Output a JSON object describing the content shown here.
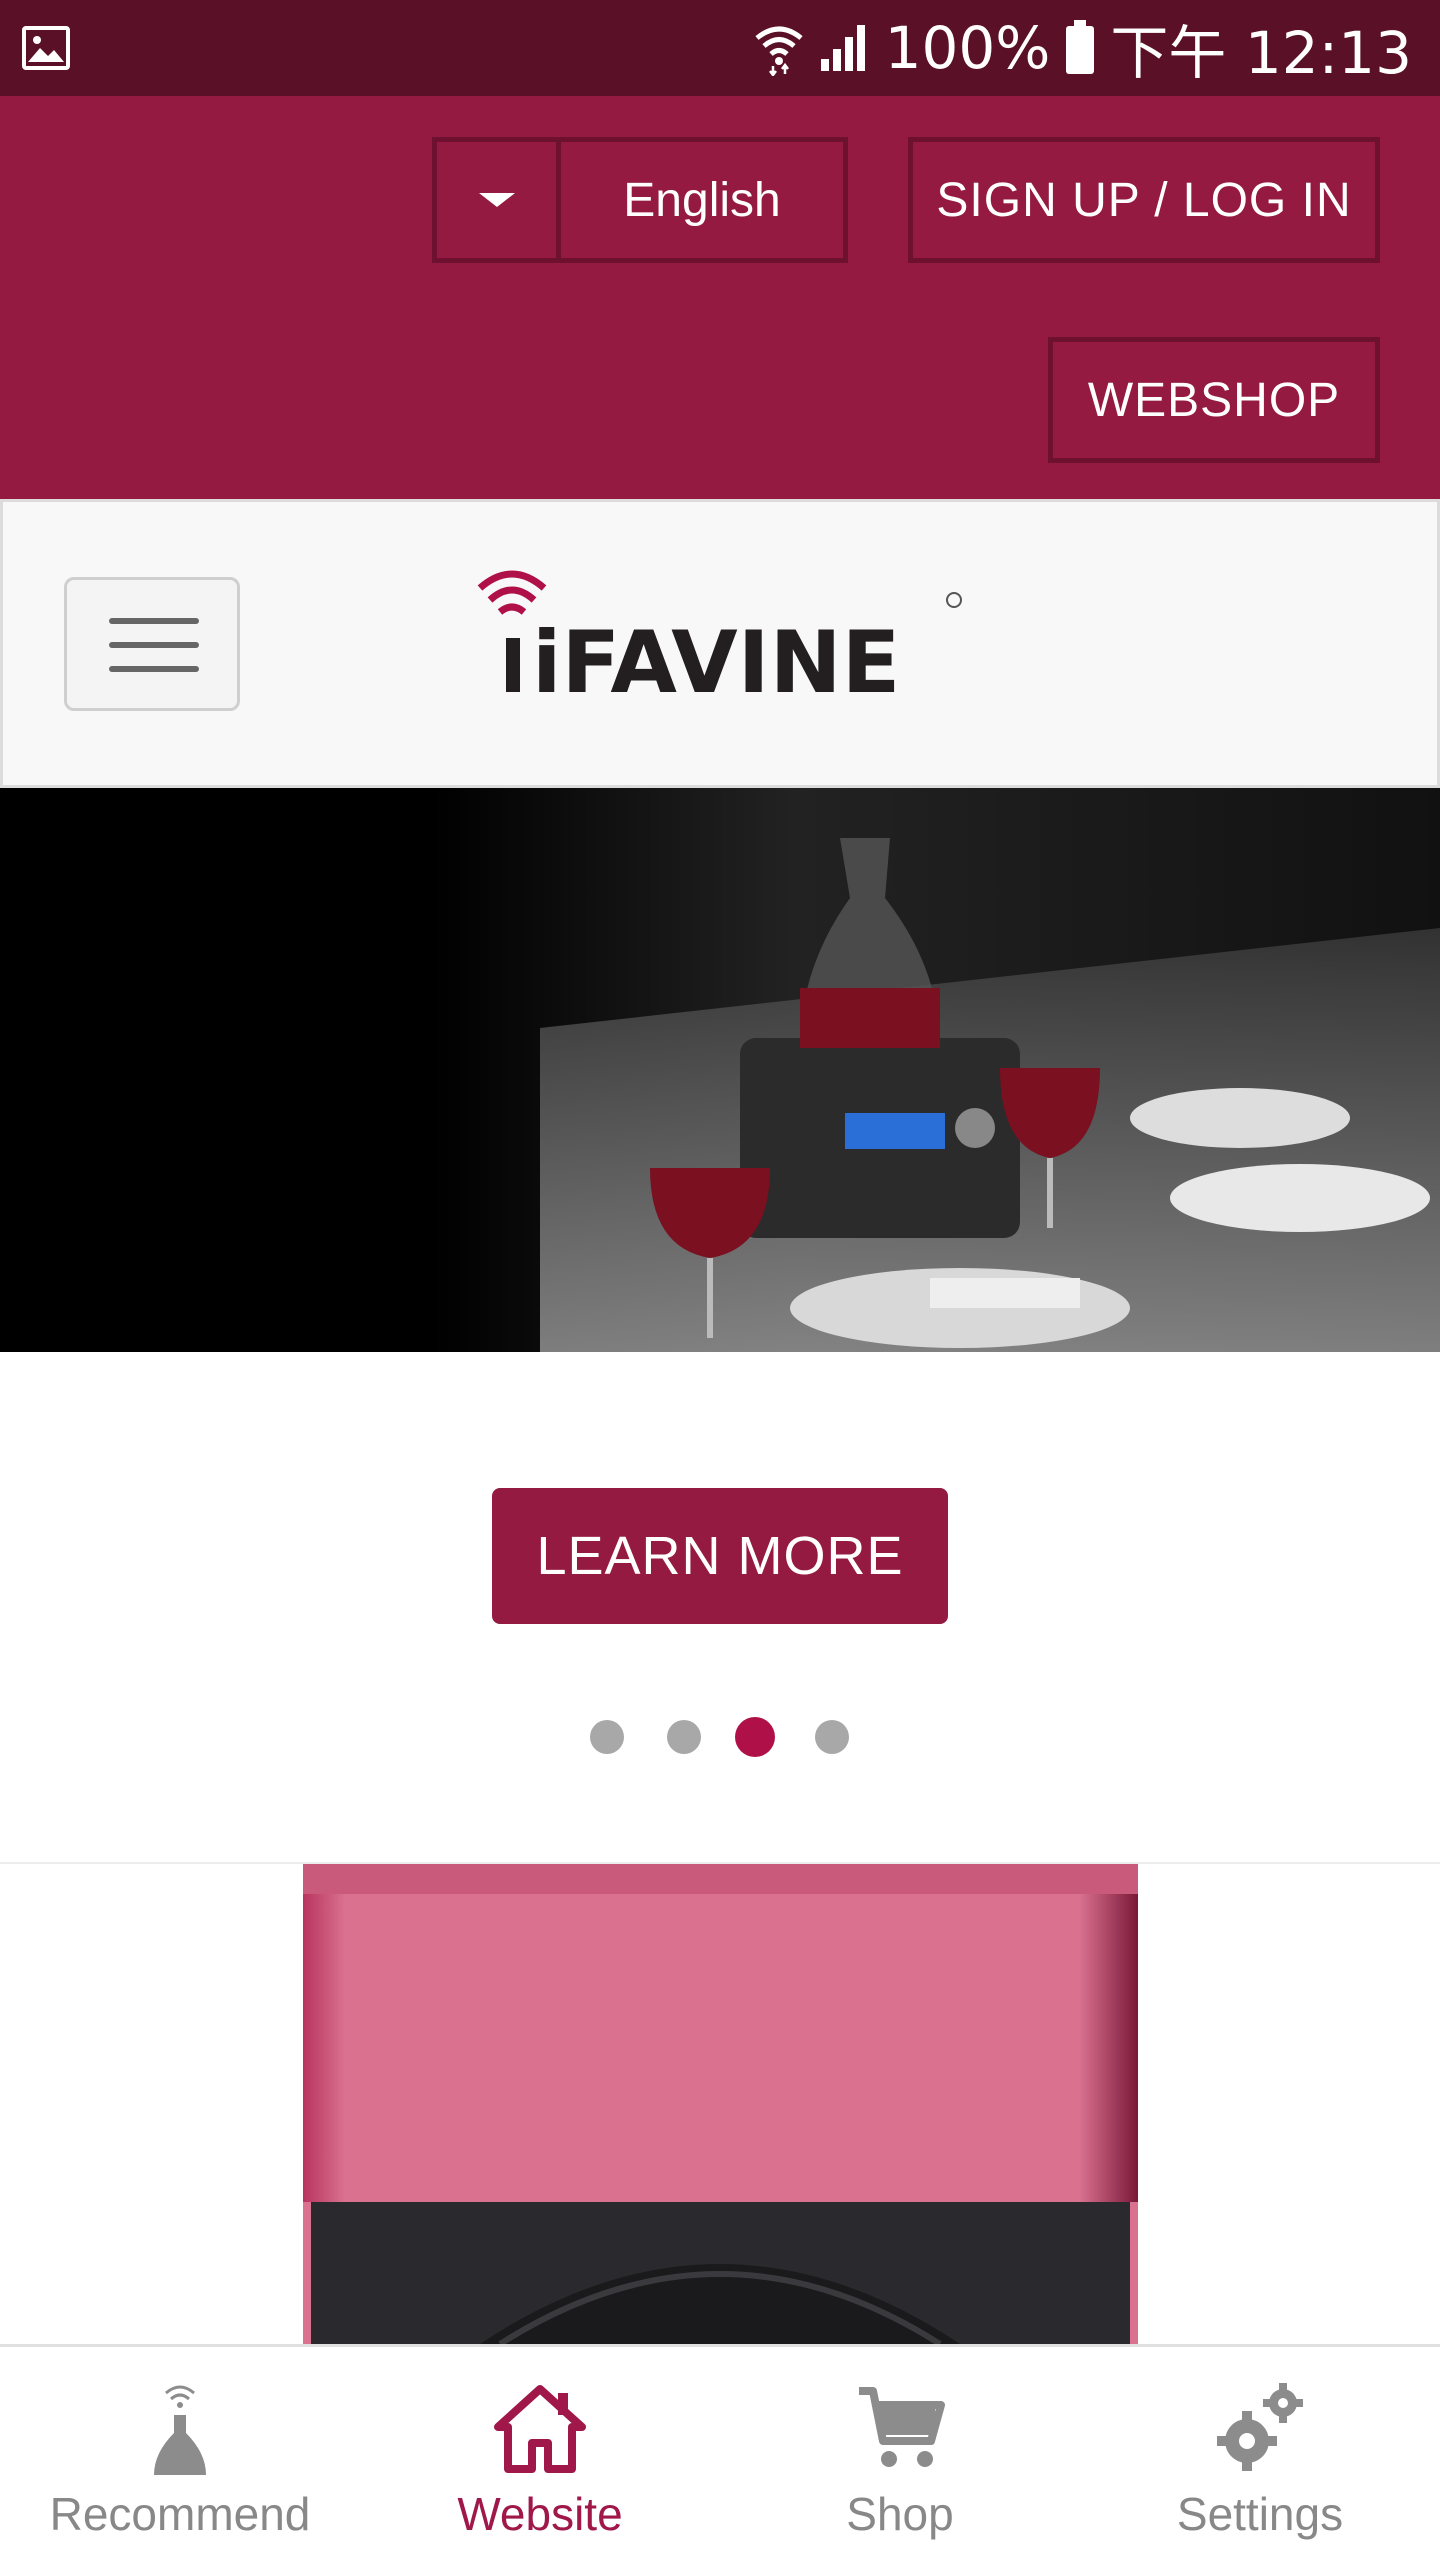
{
  "status_bar": {
    "battery": "100%",
    "time": "下午 12:13"
  },
  "header": {
    "language": "English",
    "signup_label": "SIGN UP / LOG IN",
    "webshop_label": "WEBSHOP"
  },
  "brand": {
    "logo_text": "iFAVINE",
    "accent_color": "#951a42"
  },
  "hero": {
    "cta_label": "LEARN MORE",
    "carousel_total": 4,
    "carousel_active": 3
  },
  "bottom_nav": {
    "items": [
      {
        "label": "Recommend",
        "icon": "decanter-icon",
        "active": false
      },
      {
        "label": "Website",
        "icon": "home-icon",
        "active": true
      },
      {
        "label": "Shop",
        "icon": "cart-icon",
        "active": false
      },
      {
        "label": "Settings",
        "icon": "gears-icon",
        "active": false
      }
    ]
  }
}
